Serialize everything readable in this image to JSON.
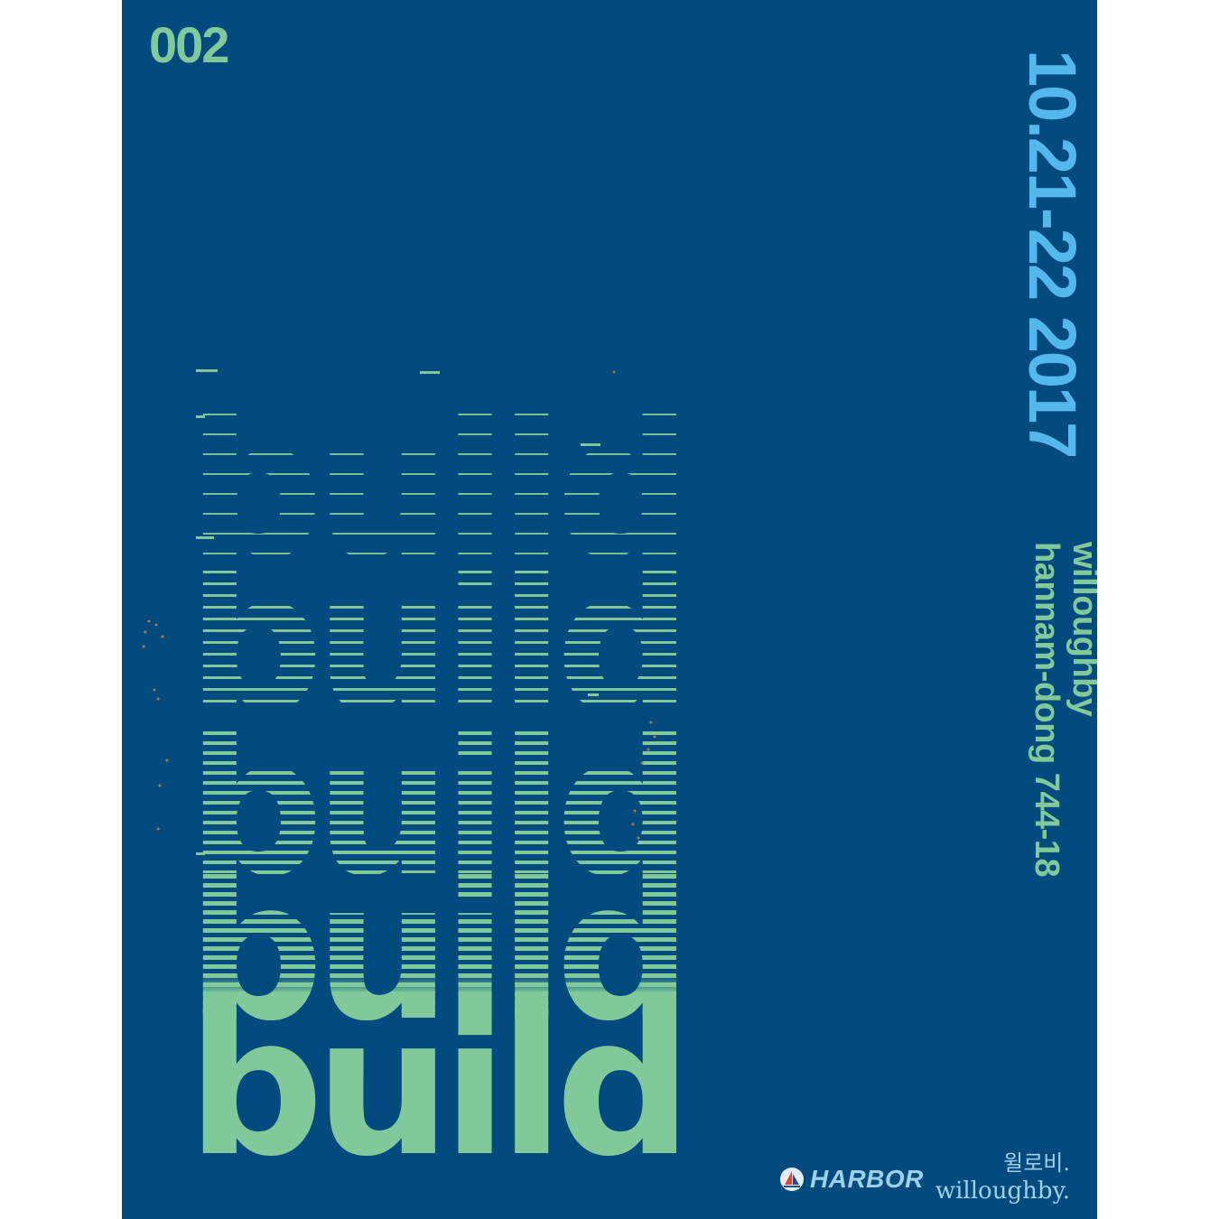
{
  "poster": {
    "issue_number": "002",
    "dates": "10.21-22 2017",
    "venue_name": "willoughby",
    "venue_address": "hannam-dong 744-18",
    "stack_word": "build",
    "harbor_label": "HARBOR",
    "willoughby_korean": "윌로비.",
    "willoughby_english": "willoughby.",
    "colors": {
      "background": "#034a7e",
      "green": "#7fc99a",
      "sky": "#55b8ec"
    }
  }
}
